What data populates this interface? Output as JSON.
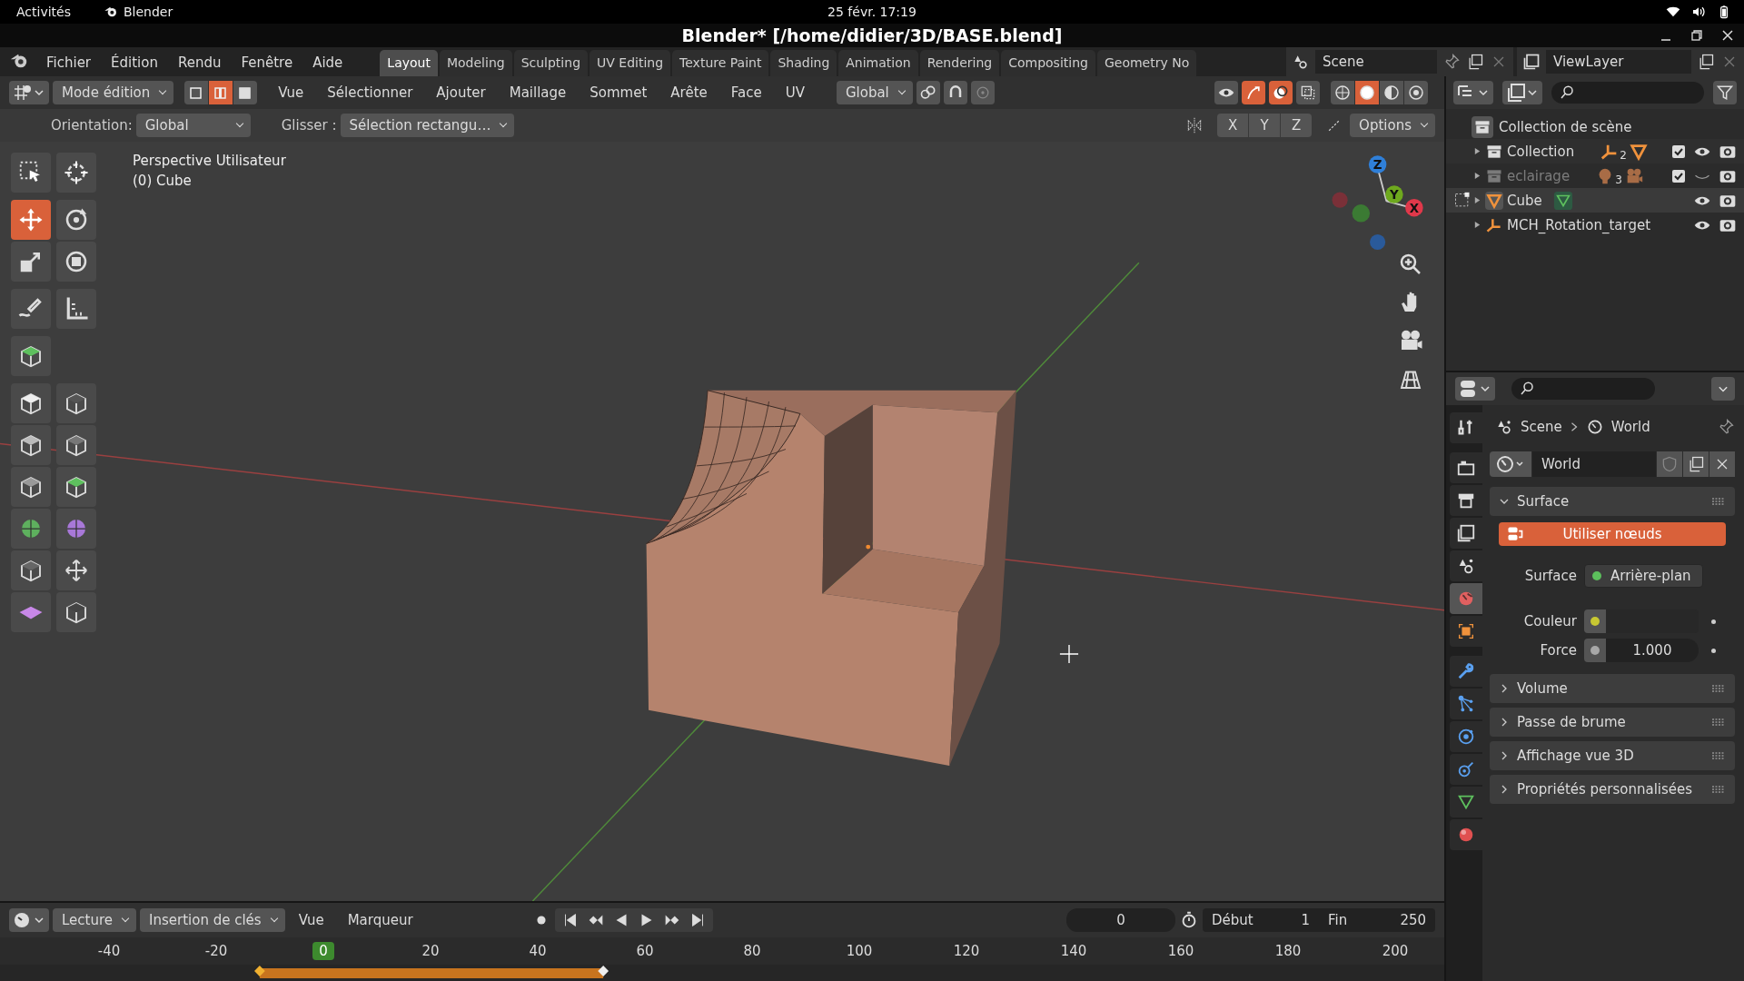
{
  "system_bar": {
    "activities": "Activités",
    "app": "Blender",
    "clock": "25 févr. 17:19"
  },
  "window": {
    "title": "Blender* [/home/didier/3D/BASE.blend]"
  },
  "menu": [
    "Fichier",
    "Édition",
    "Rendu",
    "Fenêtre",
    "Aide"
  ],
  "workspace_tabs": [
    {
      "label": "Layout",
      "selected": true
    },
    {
      "label": "Modeling",
      "selected": false
    },
    {
      "label": "Sculpting",
      "selected": false
    },
    {
      "label": "UV Editing",
      "selected": false
    },
    {
      "label": "Texture Paint",
      "selected": false
    },
    {
      "label": "Shading",
      "selected": false
    },
    {
      "label": "Animation",
      "selected": false
    },
    {
      "label": "Rendering",
      "selected": false
    },
    {
      "label": "Compositing",
      "selected": false
    },
    {
      "label": "Geometry No",
      "selected": false
    }
  ],
  "scene": {
    "name": "Scene"
  },
  "view_layer": {
    "name": "ViewLayer"
  },
  "header": {
    "mode": "Mode édition",
    "select_modes": [
      {
        "selected": false
      },
      {
        "selected": true
      },
      {
        "selected": false
      }
    ],
    "menus": [
      "Vue",
      "Sélectionner",
      "Ajouter",
      "Maillage",
      "Sommet",
      "Arête",
      "Face",
      "UV"
    ],
    "orientation": "Global",
    "gizmos_on": true,
    "overlays_on": true,
    "shading": [
      {
        "selected": false
      },
      {
        "selected": true
      },
      {
        "selected": false
      },
      {
        "selected": false
      }
    ]
  },
  "tool_settings": {
    "orientation_label": "Orientation:",
    "orientation": "Global",
    "drag_label": "Glisser :",
    "drag": "Sélection rectangu…",
    "mirror_axes": [
      "X",
      "Y",
      "Z"
    ],
    "options": "Options"
  },
  "viewport": {
    "view_name": "Perspective Utilisateur",
    "object": "(0) Cube",
    "gizmo": [
      {
        "label": "Z",
        "color": "#2f7fd8"
      },
      {
        "label": "Y",
        "color": "#6ea91e"
      },
      {
        "label": "X",
        "color": "#e0384a"
      }
    ]
  },
  "tool_groups": [
    {
      "tools": [
        {
          "kind": "select",
          "selected": false
        },
        {
          "kind": "cursor",
          "selected": false
        }
      ]
    },
    {
      "tools": [
        {
          "kind": "move",
          "selected": true
        },
        {
          "kind": "rotate",
          "selected": false
        },
        {
          "kind": "scale",
          "selected": false
        },
        {
          "kind": "transform",
          "selected": false
        }
      ]
    },
    {
      "tools": [
        {
          "kind": "annotate",
          "selected": false
        },
        {
          "kind": "measure",
          "selected": false
        }
      ]
    },
    {
      "tools": [
        {
          "kind": "add-cube",
          "selected": false
        }
      ]
    },
    {
      "tools": [
        {
          "kind": "extrude",
          "selected": false
        },
        {
          "kind": "inset",
          "selected": false
        },
        {
          "kind": "bevel",
          "selected": false
        },
        {
          "kind": "loopcut",
          "selected": false
        },
        {
          "kind": "knife",
          "selected": false
        },
        {
          "kind": "polybuild",
          "selected": false
        },
        {
          "kind": "spin",
          "selected": false
        },
        {
          "kind": "smooth",
          "selected": false
        },
        {
          "kind": "shrink",
          "selected": false
        },
        {
          "kind": "push",
          "selected": false
        },
        {
          "kind": "shear",
          "selected": false
        },
        {
          "kind": "rip",
          "selected": false
        }
      ]
    }
  ],
  "outliner": {
    "root": "Collection de scène",
    "items": [
      {
        "kind": "collection",
        "label": "Collection",
        "checked": true,
        "visible": true,
        "selected": false,
        "edit_mode": false,
        "badges": [
          {
            "kind": "empty",
            "count": "2"
          },
          {
            "kind": "mesh"
          }
        ]
      },
      {
        "kind": "collection",
        "label": "eclairage",
        "checked": true,
        "visible": false,
        "selected": false,
        "edit_mode": false,
        "badges": [
          {
            "kind": "light",
            "count": "3"
          },
          {
            "kind": "camera"
          }
        ]
      },
      {
        "kind": "mesh",
        "label": "Cube",
        "visible": true,
        "selected": true,
        "edit_mode": true,
        "badges": [
          {
            "kind": "mesh-data"
          }
        ]
      },
      {
        "kind": "empty",
        "label": "MCH_Rotation_target",
        "visible": true,
        "selected": false,
        "edit_mode": false
      }
    ]
  },
  "properties": {
    "tabs": [
      {
        "kind": "tool",
        "selected": false
      },
      {
        "kind": "render",
        "selected": false
      },
      {
        "kind": "output",
        "selected": false
      },
      {
        "kind": "view-layer",
        "selected": false
      },
      {
        "kind": "scene",
        "selected": false
      },
      {
        "kind": "world",
        "selected": true
      },
      {
        "kind": "object",
        "selected": false
      },
      {
        "kind": "modifier",
        "selected": false
      },
      {
        "kind": "particles",
        "selected": false
      },
      {
        "kind": "physics",
        "selected": false
      },
      {
        "kind": "constraints",
        "selected": false
      },
      {
        "kind": "data",
        "selected": false
      },
      {
        "kind": "material",
        "selected": false
      }
    ],
    "breadcrumb": [
      "Scene",
      "World"
    ],
    "world_name": "World",
    "panels": [
      {
        "title": "Surface",
        "expanded": true,
        "button": "Utiliser nœuds",
        "fields": [
          {
            "label": "Surface",
            "kind": "link",
            "value": "Arrière-plan",
            "color": "#5cbf5c"
          },
          {
            "label": "Couleur",
            "kind": "color",
            "color": "#c8c832"
          },
          {
            "label": "Force",
            "kind": "number",
            "value": "1.000",
            "color": "#a8a8a8"
          }
        ]
      },
      {
        "title": "Volume",
        "expanded": false
      },
      {
        "title": "Passe de brume",
        "expanded": false
      },
      {
        "title": "Affichage vue 3D",
        "expanded": false
      },
      {
        "title": "Propriétés personnalisées",
        "expanded": false
      }
    ]
  },
  "timeline": {
    "menus": [
      "Lecture",
      "Insertion de clés",
      "Vue",
      "Marqueur"
    ],
    "frame": "0",
    "start_label": "Début",
    "start": "1",
    "end_label": "Fin",
    "end": "250",
    "ruler": [
      {
        "label": "-40",
        "current": false
      },
      {
        "label": "-20",
        "current": false
      },
      {
        "label": "0",
        "current": true
      },
      {
        "label": "20",
        "current": false
      },
      {
        "label": "40",
        "current": false
      },
      {
        "label": "60",
        "current": false
      },
      {
        "label": "80",
        "current": false
      },
      {
        "label": "100",
        "current": false
      },
      {
        "label": "120",
        "current": false
      },
      {
        "label": "140",
        "current": false
      },
      {
        "label": "160",
        "current": false
      },
      {
        "label": "180",
        "current": false
      },
      {
        "label": "200",
        "current": false
      }
    ]
  }
}
